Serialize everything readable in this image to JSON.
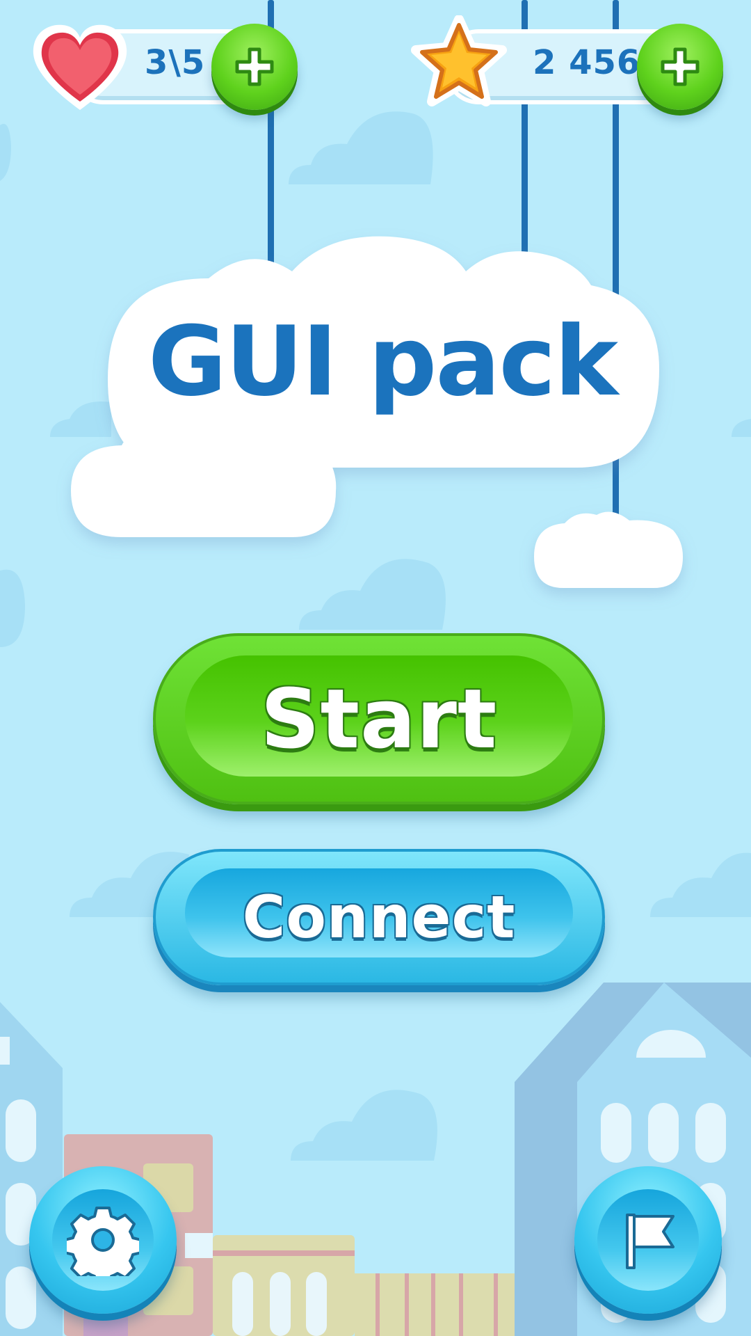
{
  "hud": {
    "lives": {
      "icon": "heart-icon",
      "value": "3\\5",
      "add_icon": "plus-icon"
    },
    "stars": {
      "icon": "star-icon",
      "value": "2 456",
      "add_icon": "plus-icon"
    }
  },
  "title": "GUI pack",
  "buttons": {
    "start_label": "Start",
    "connect_label": "Connect",
    "settings_icon": "gear-icon",
    "flag_icon": "flag-icon"
  },
  "colors": {
    "sky": "#b9ebfb",
    "title_blue": "#1b73bd",
    "green": "#5fd21d",
    "cyan": "#2bb8e4"
  }
}
